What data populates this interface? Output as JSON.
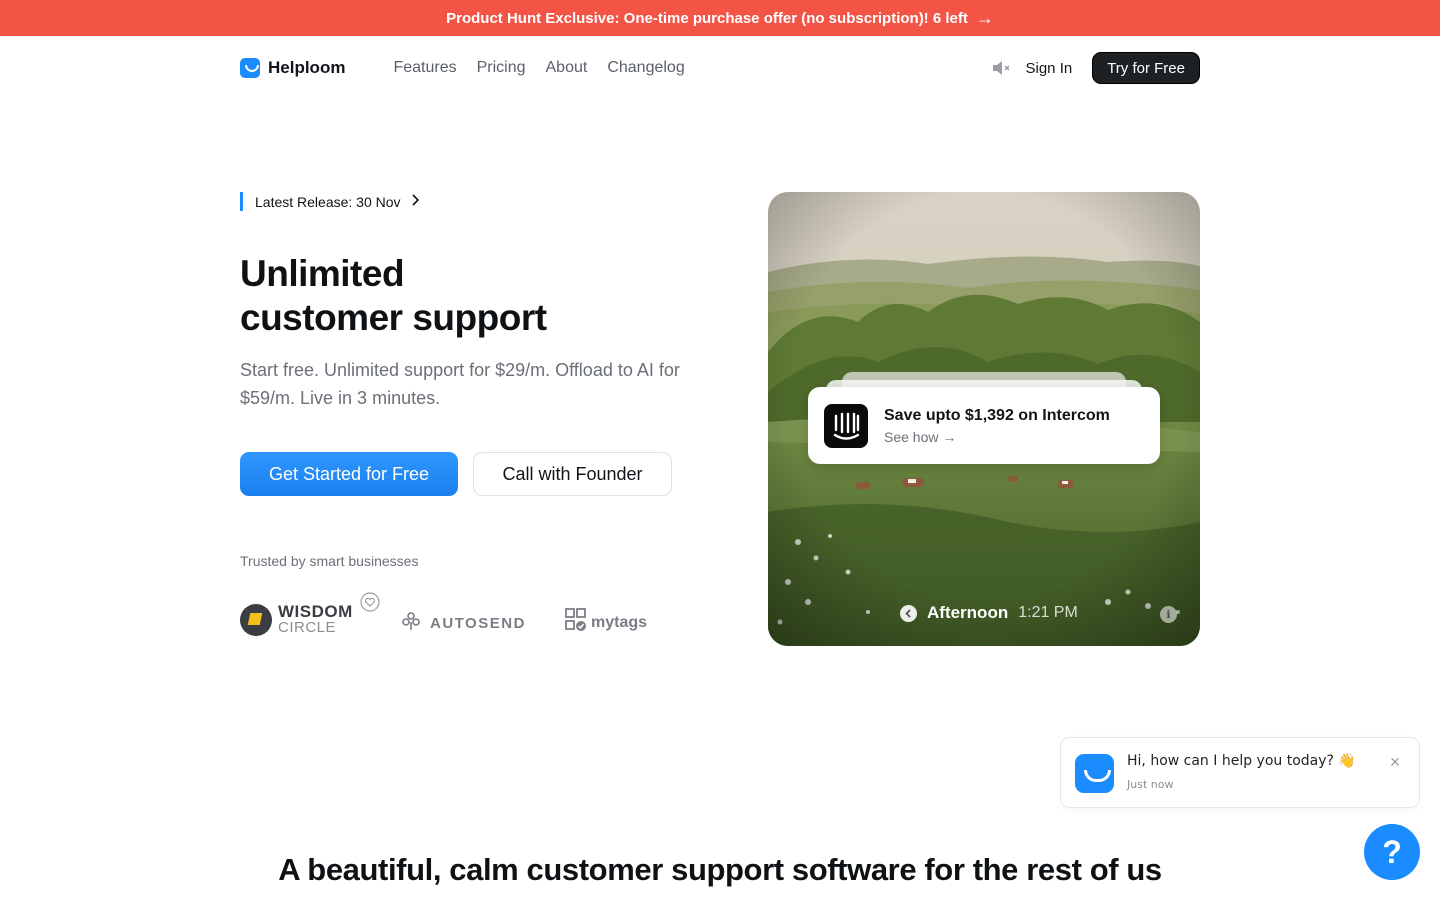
{
  "promo": {
    "text": "Product Hunt Exclusive: One-time purchase offer (no subscription)! 6 left",
    "arrow": "→"
  },
  "nav": {
    "brand": "Helploom",
    "links": [
      "Features",
      "Pricing",
      "About",
      "Changelog"
    ],
    "sign_in": "Sign In",
    "try_free": "Try for Free"
  },
  "hero": {
    "release": "Latest Release: 30 Nov",
    "headline_line1": "Unlimited",
    "headline_line2": "customer support",
    "subtitle": "Start free. Unlimited support for $29/m. Offload to AI for $59/m. Live in 3 minutes.",
    "cta_primary": "Get Started for Free",
    "cta_secondary": "Call with Founder",
    "trusted": "Trusted by smart businesses",
    "logos": {
      "wisdom_line1": "WISDOM",
      "wisdom_line2": "CIRCLE",
      "autosend": "AUTOSEND",
      "mytags": "mytags"
    }
  },
  "image_card": {
    "offer_title": "Save upto $1,392 on Intercom",
    "offer_link": "See how →",
    "time_label": "Afternoon",
    "time_value": "1:21 PM",
    "info": "i"
  },
  "chat": {
    "message": "Hi, how can I help you today? 👋",
    "time": "Just now",
    "close": "×",
    "help": "?"
  },
  "section": {
    "heading": "A beautiful, calm customer support software for the rest of us"
  },
  "colors": {
    "accent": "#1a8cff",
    "promo": "#f35446",
    "dark": "#1e2124"
  }
}
